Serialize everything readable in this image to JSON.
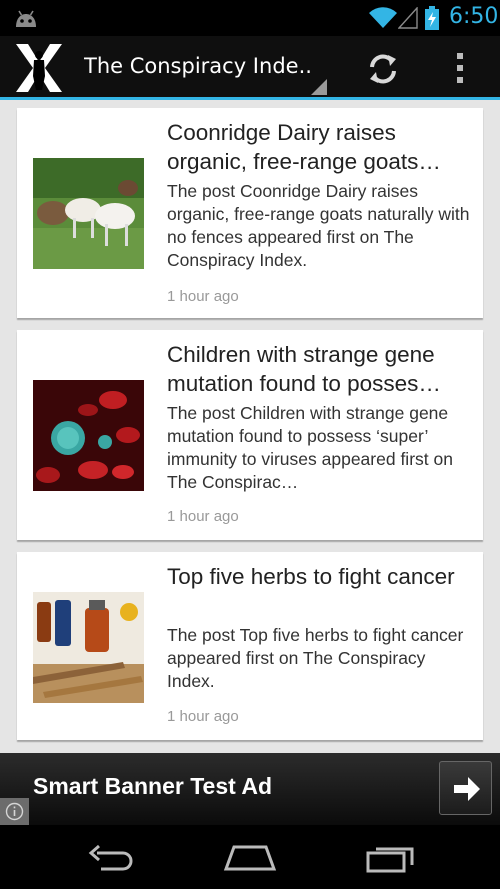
{
  "status_bar": {
    "time": "6:50",
    "icons": [
      "android-icon",
      "wifi-icon",
      "signal-icon",
      "battery-charging-icon"
    ],
    "accent_color": "#33b5e5"
  },
  "action_bar": {
    "title": "The Conspiracy Inde..",
    "logo_icon": "x-logo-icon",
    "actions": [
      "refresh-icon",
      "overflow-menu-icon"
    ],
    "accent_color": "#33b5e5"
  },
  "articles": [
    {
      "title": "Coonridge Dairy raises organic, free-range goats…",
      "excerpt": "The post Coonridge Dairy raises organic, free-range goats naturally with no fences appeared first on The Conspiracy Index.",
      "time": "1 hour ago"
    },
    {
      "title": "Children with strange gene mutation found to posses…",
      "excerpt": "The post Children with strange gene mutation found to possess ‘super’ immunity to viruses appeared first on The Conspirac…",
      "time": "1 hour ago"
    },
    {
      "title": "Top five herbs to fight cancer",
      "excerpt": "The post Top five herbs to fight cancer appeared first on The Conspiracy Index.",
      "time": "1 hour ago"
    }
  ],
  "ad": {
    "text": "Smart Banner Test Ad",
    "icons": [
      "arrow-right-icon",
      "info-icon"
    ]
  },
  "nav_bar": {
    "buttons": [
      "back-icon",
      "home-icon",
      "recent-apps-icon"
    ]
  }
}
